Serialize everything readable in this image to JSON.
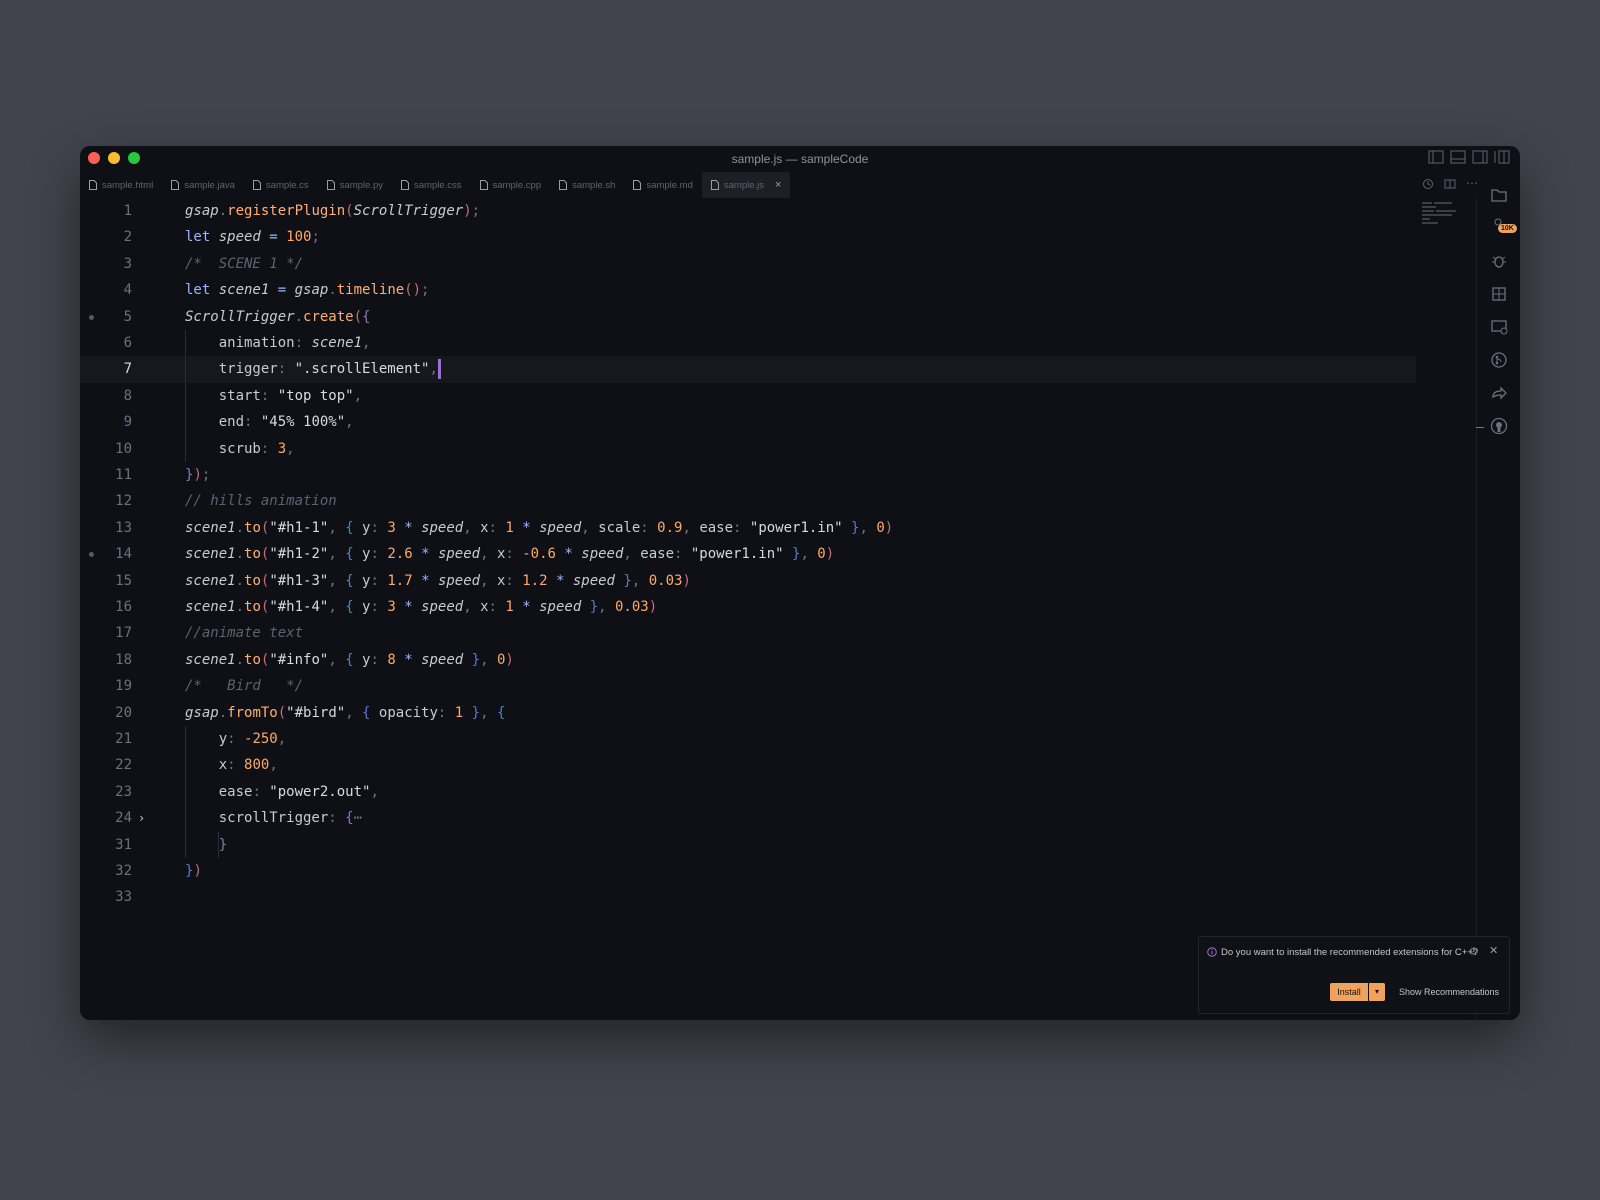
{
  "window": {
    "title": "sample.js — sampleCode"
  },
  "tabs": [
    {
      "label": "sample.html"
    },
    {
      "label": "sample.java"
    },
    {
      "label": "sample.cs"
    },
    {
      "label": "sample.py"
    },
    {
      "label": "sample.css"
    },
    {
      "label": "sample.cpp"
    },
    {
      "label": "sample.sh"
    },
    {
      "label": "sample.md"
    },
    {
      "label": "sample.js",
      "active": true
    }
  ],
  "activity_bar": {
    "badge": "10K",
    "icons": [
      "explorer-icon",
      "search-icon",
      "debug-icon",
      "extensions-icon",
      "remote-explorer-icon",
      "source-control-icon",
      "live-share-icon",
      "github-icon"
    ]
  },
  "editor": {
    "current_line": 7,
    "line_numbers": [
      "1",
      "2",
      "3",
      "4",
      "5",
      "6",
      "7",
      "8",
      "9",
      "10",
      "11",
      "12",
      "13",
      "14",
      "15",
      "16",
      "17",
      "18",
      "19",
      "20",
      "21",
      "22",
      "23",
      "24",
      "31",
      "32",
      "33"
    ],
    "lines": [
      [
        [
          "var",
          "gsap"
        ],
        [
          "pun",
          "."
        ],
        [
          "fn",
          "registerPlugin"
        ],
        [
          "brk3",
          "("
        ],
        [
          "var",
          "ScrollTrigger"
        ],
        [
          "brk3",
          ")"
        ],
        [
          "pun",
          ";"
        ]
      ],
      [
        [
          "kw",
          "let "
        ],
        [
          "var",
          "speed"
        ],
        [
          "op",
          " = "
        ],
        [
          "num",
          "100"
        ],
        [
          "pun",
          ";"
        ]
      ],
      [
        [
          "cmt",
          "/*  SCENE 1 */"
        ]
      ],
      [
        [
          "kw",
          "let "
        ],
        [
          "var",
          "scene1"
        ],
        [
          "op",
          " = "
        ],
        [
          "var",
          "gsap"
        ],
        [
          "pun",
          "."
        ],
        [
          "fn",
          "timeline"
        ],
        [
          "brk3",
          "()"
        ],
        [
          "pun",
          ";"
        ]
      ],
      [
        [
          "var",
          "ScrollTrigger"
        ],
        [
          "pun",
          "."
        ],
        [
          "fn",
          "create"
        ],
        [
          "brk3",
          "("
        ],
        [
          "brk",
          "{"
        ]
      ],
      [
        [
          "prop",
          "    animation"
        ],
        [
          "pun",
          ": "
        ],
        [
          "var",
          "scene1"
        ],
        [
          "pun",
          ","
        ]
      ],
      [
        [
          "prop",
          "    trigger"
        ],
        [
          "pun",
          ": "
        ],
        [
          "str",
          "\".scrollElement\""
        ],
        [
          "pun",
          ","
        ]
      ],
      [
        [
          "prop",
          "    start"
        ],
        [
          "pun",
          ": "
        ],
        [
          "str",
          "\"top top\""
        ],
        [
          "pun",
          ","
        ]
      ],
      [
        [
          "prop",
          "    end"
        ],
        [
          "pun",
          ": "
        ],
        [
          "str",
          "\"45% 100%\""
        ],
        [
          "pun",
          ","
        ]
      ],
      [
        [
          "prop",
          "    scrub"
        ],
        [
          "pun",
          ": "
        ],
        [
          "num",
          "3"
        ],
        [
          "pun",
          ","
        ]
      ],
      [
        [
          "brk",
          "}"
        ],
        [
          "brk3",
          ")"
        ],
        [
          "pun",
          ";"
        ]
      ],
      [
        [
          "cmt",
          "// hills animation"
        ]
      ],
      [
        [
          "var",
          "scene1"
        ],
        [
          "pun",
          "."
        ],
        [
          "fn",
          "to"
        ],
        [
          "brk3",
          "("
        ],
        [
          "str",
          "\"#h1-1\""
        ],
        [
          "pun",
          ", "
        ],
        [
          "brk2",
          "{ "
        ],
        [
          "prop",
          "y"
        ],
        [
          "pun",
          ": "
        ],
        [
          "num",
          "3"
        ],
        [
          "op",
          " * "
        ],
        [
          "var",
          "speed"
        ],
        [
          "pun",
          ", "
        ],
        [
          "prop",
          "x"
        ],
        [
          "pun",
          ": "
        ],
        [
          "num",
          "1"
        ],
        [
          "op",
          " * "
        ],
        [
          "var",
          "speed"
        ],
        [
          "pun",
          ", "
        ],
        [
          "prop",
          "scale"
        ],
        [
          "pun",
          ": "
        ],
        [
          "num",
          "0.9"
        ],
        [
          "pun",
          ", "
        ],
        [
          "prop",
          "ease"
        ],
        [
          "pun",
          ": "
        ],
        [
          "str",
          "\"power1.in\""
        ],
        [
          "brk2",
          " }"
        ],
        [
          "pun",
          ", "
        ],
        [
          "num",
          "0"
        ],
        [
          "brk3",
          ")"
        ]
      ],
      [
        [
          "var",
          "scene1"
        ],
        [
          "pun",
          "."
        ],
        [
          "fn",
          "to"
        ],
        [
          "brk3",
          "("
        ],
        [
          "str",
          "\"#h1-2\""
        ],
        [
          "pun",
          ", "
        ],
        [
          "brk2",
          "{ "
        ],
        [
          "prop",
          "y"
        ],
        [
          "pun",
          ": "
        ],
        [
          "num",
          "2.6"
        ],
        [
          "op",
          " * "
        ],
        [
          "var",
          "speed"
        ],
        [
          "pun",
          ", "
        ],
        [
          "prop",
          "x"
        ],
        [
          "pun",
          ": "
        ],
        [
          "num",
          "-0.6"
        ],
        [
          "op",
          " * "
        ],
        [
          "var",
          "speed"
        ],
        [
          "pun",
          ", "
        ],
        [
          "prop",
          "ease"
        ],
        [
          "pun",
          ": "
        ],
        [
          "str",
          "\"power1.in\""
        ],
        [
          "brk2",
          " }"
        ],
        [
          "pun",
          ", "
        ],
        [
          "num",
          "0"
        ],
        [
          "brk3",
          ")"
        ]
      ],
      [
        [
          "var",
          "scene1"
        ],
        [
          "pun",
          "."
        ],
        [
          "fn",
          "to"
        ],
        [
          "brk3",
          "("
        ],
        [
          "str",
          "\"#h1-3\""
        ],
        [
          "pun",
          ", "
        ],
        [
          "brk2",
          "{ "
        ],
        [
          "prop",
          "y"
        ],
        [
          "pun",
          ": "
        ],
        [
          "num",
          "1.7"
        ],
        [
          "op",
          " * "
        ],
        [
          "var",
          "speed"
        ],
        [
          "pun",
          ", "
        ],
        [
          "prop",
          "x"
        ],
        [
          "pun",
          ": "
        ],
        [
          "num",
          "1.2"
        ],
        [
          "op",
          " * "
        ],
        [
          "var",
          "speed"
        ],
        [
          "brk2",
          " }"
        ],
        [
          "pun",
          ", "
        ],
        [
          "num",
          "0.03"
        ],
        [
          "brk3",
          ")"
        ]
      ],
      [
        [
          "var",
          "scene1"
        ],
        [
          "pun",
          "."
        ],
        [
          "fn",
          "to"
        ],
        [
          "brk3",
          "("
        ],
        [
          "str",
          "\"#h1-4\""
        ],
        [
          "pun",
          ", "
        ],
        [
          "brk2",
          "{ "
        ],
        [
          "prop",
          "y"
        ],
        [
          "pun",
          ": "
        ],
        [
          "num",
          "3"
        ],
        [
          "op",
          " * "
        ],
        [
          "var",
          "speed"
        ],
        [
          "pun",
          ", "
        ],
        [
          "prop",
          "x"
        ],
        [
          "pun",
          ": "
        ],
        [
          "num",
          "1"
        ],
        [
          "op",
          " * "
        ],
        [
          "var",
          "speed"
        ],
        [
          "brk2",
          " }"
        ],
        [
          "pun",
          ", "
        ],
        [
          "num",
          "0.03"
        ],
        [
          "brk3",
          ")"
        ]
      ],
      [
        [
          "cmt",
          "//animate text"
        ]
      ],
      [
        [
          "var",
          "scene1"
        ],
        [
          "pun",
          "."
        ],
        [
          "fn",
          "to"
        ],
        [
          "brk3",
          "("
        ],
        [
          "str",
          "\"#info\""
        ],
        [
          "pun",
          ", "
        ],
        [
          "brk2",
          "{ "
        ],
        [
          "prop",
          "y"
        ],
        [
          "pun",
          ": "
        ],
        [
          "num",
          "8"
        ],
        [
          "op",
          " * "
        ],
        [
          "var",
          "speed"
        ],
        [
          "brk2",
          " }"
        ],
        [
          "pun",
          ", "
        ],
        [
          "num",
          "0"
        ],
        [
          "brk3",
          ")"
        ]
      ],
      [
        [
          "cmt",
          "/*   Bird   */"
        ]
      ],
      [
        [
          "var",
          "gsap"
        ],
        [
          "pun",
          "."
        ],
        [
          "fn",
          "fromTo"
        ],
        [
          "brk3",
          "("
        ],
        [
          "str",
          "\"#bird\""
        ],
        [
          "pun",
          ", "
        ],
        [
          "brk2",
          "{ "
        ],
        [
          "prop",
          "opacity"
        ],
        [
          "pun",
          ": "
        ],
        [
          "num",
          "1"
        ],
        [
          "brk2",
          " }"
        ],
        [
          "pun",
          ", "
        ],
        [
          "brk2",
          "{"
        ]
      ],
      [
        [
          "prop",
          "    y"
        ],
        [
          "pun",
          ": "
        ],
        [
          "num",
          "-250"
        ],
        [
          "pun",
          ","
        ]
      ],
      [
        [
          "prop",
          "    x"
        ],
        [
          "pun",
          ": "
        ],
        [
          "num",
          "800"
        ],
        [
          "pun",
          ","
        ]
      ],
      [
        [
          "prop",
          "    ease"
        ],
        [
          "pun",
          ": "
        ],
        [
          "str",
          "\"power2.out\""
        ],
        [
          "pun",
          ","
        ]
      ],
      [
        [
          "prop",
          "    scrollTrigger"
        ],
        [
          "pun",
          ": "
        ],
        [
          "brk",
          "{"
        ],
        [
          "pun",
          "⋯"
        ]
      ],
      [
        [
          "brk",
          "    }"
        ]
      ],
      [
        [
          "brk2",
          "}"
        ],
        [
          "brk3",
          ")"
        ]
      ],
      []
    ],
    "breakpoint_dots": [
      "5",
      "14"
    ],
    "folded_line": "24"
  },
  "notification": {
    "message": "Do you want to install the recommended extensions for C++?",
    "install_label": "Install",
    "show_label": "Show Recommendations"
  },
  "colors": {
    "window_bg": "#0e1015",
    "desktop_bg": "#42434d",
    "accent": "#f0a35e",
    "cursor": "#a06fd2"
  }
}
